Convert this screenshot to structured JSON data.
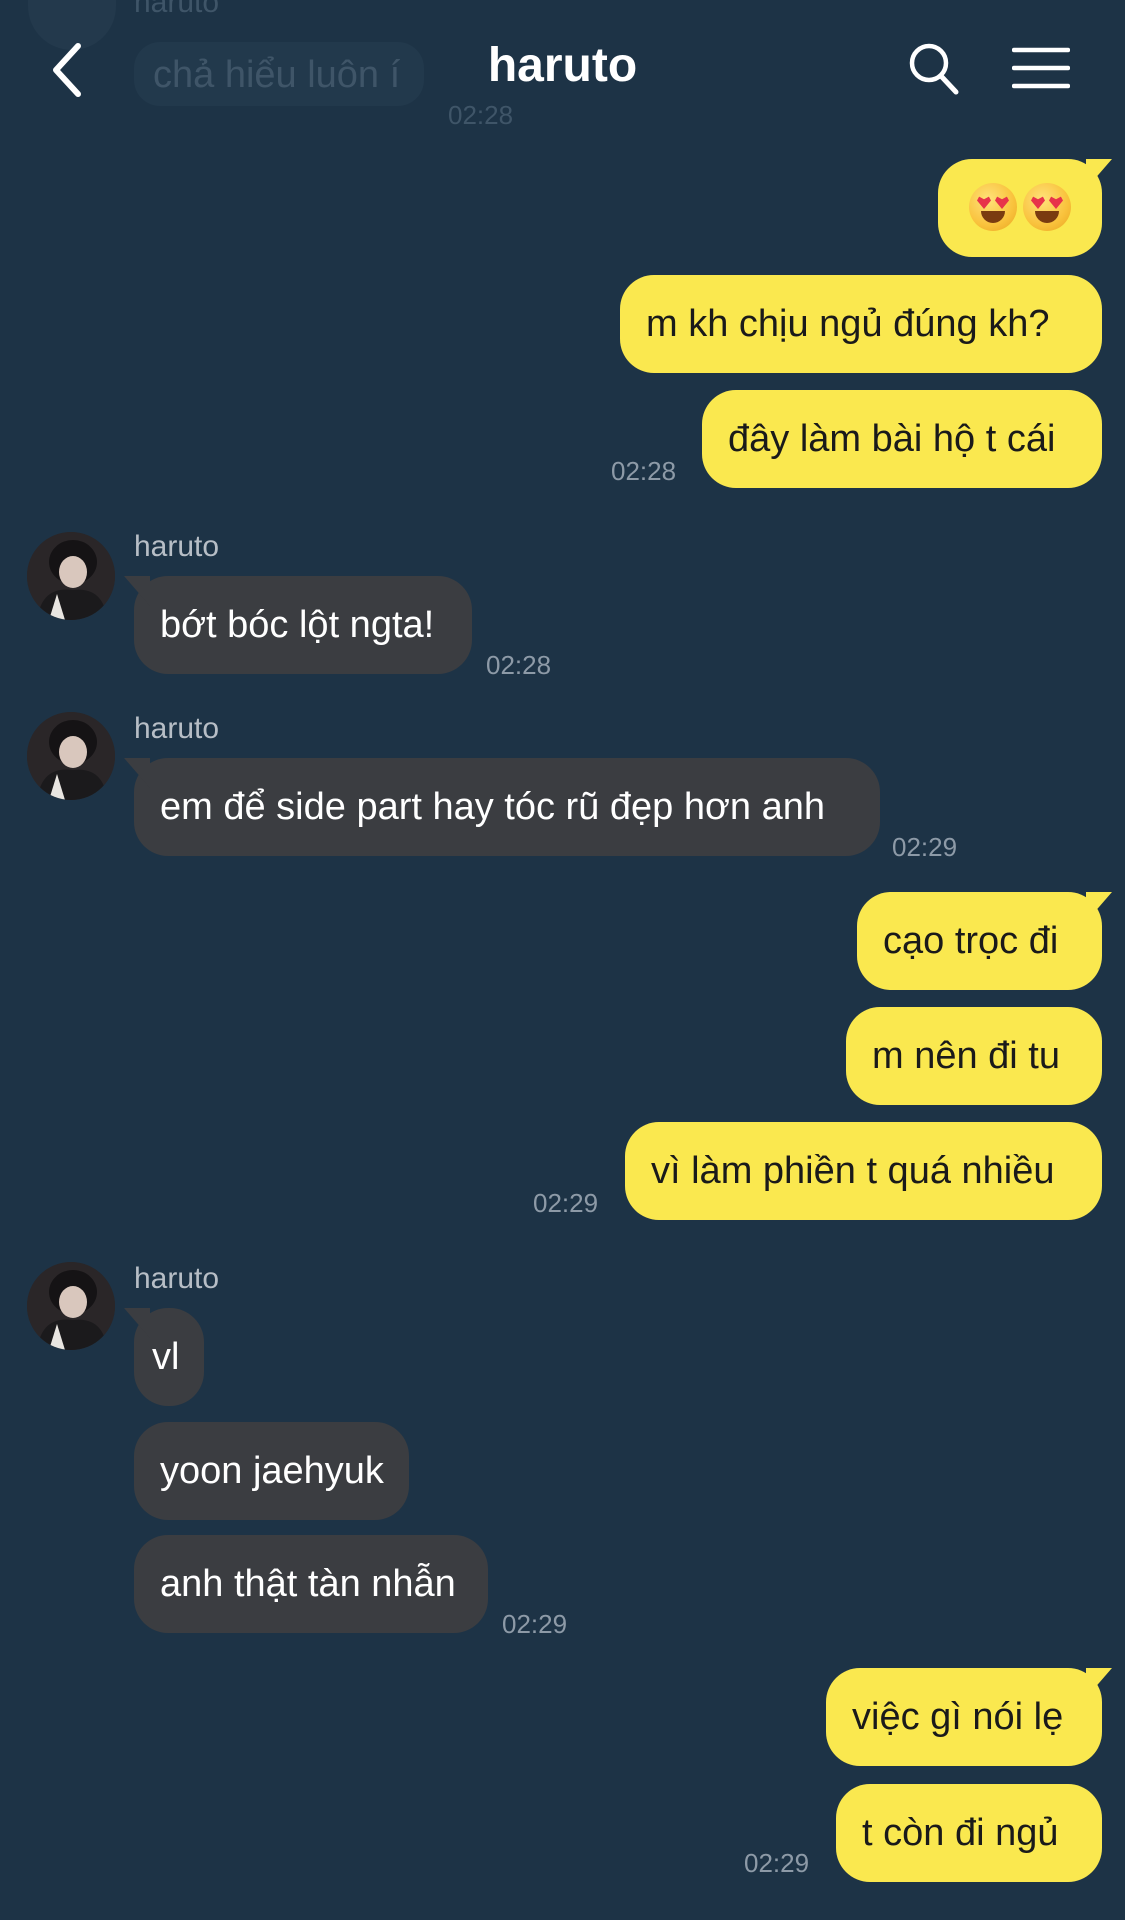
{
  "header": {
    "title": "haruto",
    "back_icon": "chevron-left-icon",
    "search_icon": "search-icon",
    "menu_icon": "hamburger-menu-icon"
  },
  "ghost": {
    "sender": "haruto",
    "text": "chả hiểu luôn í",
    "time": "02:28"
  },
  "emoji_message": {
    "icon": "heart-eyes-emoji",
    "count": 2
  },
  "messages": {
    "m1": "m kh chịu ngủ đúng kh?",
    "m2": "đây làm bài hộ t cái",
    "m2_time": "02:28",
    "s1": "haruto",
    "m3": "bớt bóc lột ngta!",
    "m3_time": "02:28",
    "s2": "haruto",
    "m4": "em để side part hay tóc rũ đẹp hơn anh",
    "m4_time": "02:29",
    "m5": "cạo trọc đi",
    "m6": "m nên đi tu",
    "m7": "vì làm phiền t quá nhiều",
    "m7_time": "02:29",
    "s3": "haruto",
    "m8": "vl",
    "m9": "yoon jaehyuk",
    "m10": "anh thật tàn nhẫn",
    "m10_time": "02:29",
    "m11": "việc gì nói lẹ",
    "m12": "t còn đi ngủ",
    "m12_time": "02:29"
  },
  "colors": {
    "background": "#1d3346",
    "outgoing_bubble": "#fae84f",
    "incoming_bubble": "#3b3d41",
    "timestamp": "#8d9aa7"
  }
}
